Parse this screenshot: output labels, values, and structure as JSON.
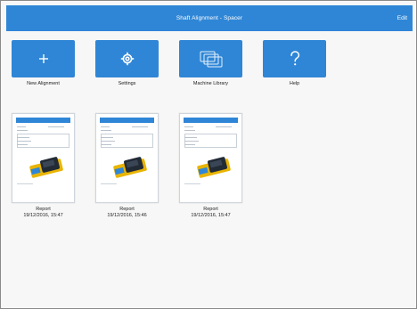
{
  "header": {
    "title": "Shaft Alignment - Spacer",
    "edit_label": "Edit"
  },
  "tiles": [
    {
      "label": "New Alignment",
      "icon": "plus-icon"
    },
    {
      "label": "Settings",
      "icon": "gear-icon"
    },
    {
      "label": "Machine Library",
      "icon": "machine-library-icon"
    },
    {
      "label": "Help",
      "icon": "help-icon"
    }
  ],
  "reports": [
    {
      "title": "Report",
      "date": "19/12/2016, 15:47"
    },
    {
      "title": "Report",
      "date": "19/12/2016, 15:46"
    },
    {
      "title": "Report",
      "date": "19/12/2016, 15:47"
    }
  ],
  "colors": {
    "accent": "#2f86d6",
    "background": "#f7f7f7"
  }
}
